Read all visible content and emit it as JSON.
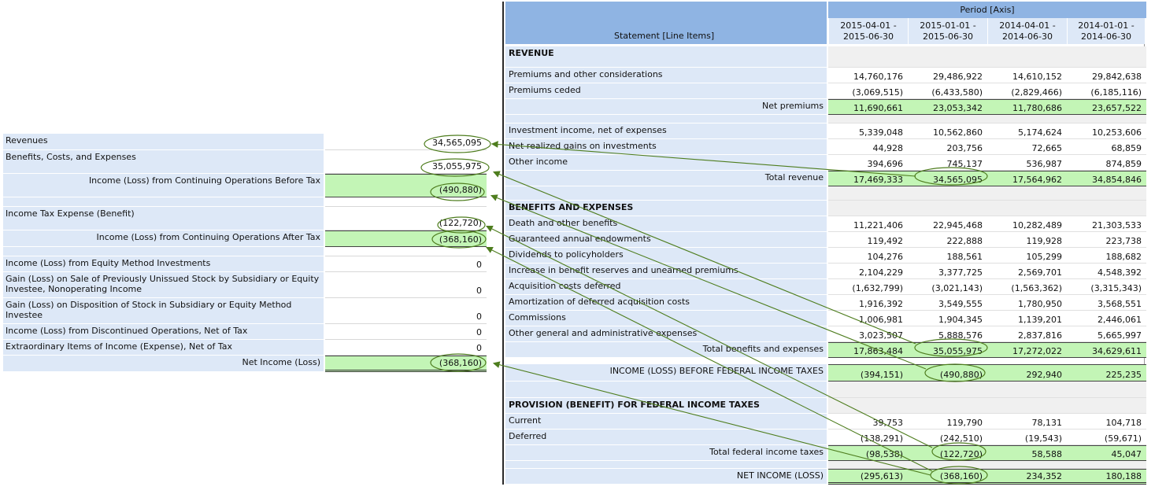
{
  "left_table": {
    "rows": [
      {
        "label": "Revenues",
        "value": "34,565,095"
      },
      {
        "label": "Benefits, Costs, and Expenses",
        "value": "35,055,975"
      },
      {
        "label": "Income (Loss) from Continuing Operations Before Tax",
        "value": "(490,880)"
      },
      {
        "label": "Income Tax Expense (Benefit)",
        "value": "(122,720)"
      },
      {
        "label": "Income (Loss) from Continuing Operations After Tax",
        "value": "(368,160)"
      },
      {
        "label": "Income (Loss) from Equity Method Investments",
        "value": "0"
      },
      {
        "label": "Gain (Loss) on Sale of Previously Unissued Stock by Subsidiary or Equity Investee, Nonoperating Income",
        "value": "0"
      },
      {
        "label": "Gain (Loss) on Disposition of Stock in Subsidiary or Equity Method Investee",
        "value": "0"
      },
      {
        "label": "Income (Loss) from Discontinued Operations, Net of Tax",
        "value": "0"
      },
      {
        "label": "Extraordinary Items of Income (Expense), Net of Tax",
        "value": "0"
      },
      {
        "label": "Net Income (Loss)",
        "value": "(368,160)"
      }
    ]
  },
  "right_table": {
    "header_label": "Statement [Line Items]",
    "period_axis": "Period [Axis]",
    "columns": [
      {
        "line1": "2015-04-01 -",
        "line2": "2015-06-30"
      },
      {
        "line1": "2015-01-01 -",
        "line2": "2015-06-30"
      },
      {
        "line1": "2014-04-01 -",
        "line2": "2014-06-30"
      },
      {
        "line1": "2014-01-01 -",
        "line2": "2014-06-30"
      }
    ],
    "rows": [
      {
        "label": "REVENUE",
        "values": [
          "",
          "",
          "",
          ""
        ]
      },
      {
        "label": "Premiums and other considerations",
        "values": [
          "14,760,176",
          "29,486,922",
          "14,610,152",
          "29,842,638"
        ]
      },
      {
        "label": "Premiums ceded",
        "values": [
          "(3,069,515)",
          "(6,433,580)",
          "(2,829,466)",
          "(6,185,116)"
        ]
      },
      {
        "label": "Net premiums",
        "values": [
          "11,690,661",
          "23,053,342",
          "11,780,686",
          "23,657,522"
        ]
      },
      {
        "label": "",
        "values": [
          "",
          "",
          "",
          ""
        ]
      },
      {
        "label": "Investment income, net of expenses",
        "values": [
          "5,339,048",
          "10,562,860",
          "5,174,624",
          "10,253,606"
        ]
      },
      {
        "label": "Net realized gains on investments",
        "values": [
          "44,928",
          "203,756",
          "72,665",
          "68,859"
        ]
      },
      {
        "label": "Other income",
        "values": [
          "394,696",
          "745,137",
          "536,987",
          "874,859"
        ]
      },
      {
        "label": "Total revenue",
        "values": [
          "17,469,333",
          "34,565,095",
          "17,564,962",
          "34,854,846"
        ]
      },
      {
        "label": "",
        "values": [
          "",
          "",
          "",
          ""
        ]
      },
      {
        "label": "BENEFITS AND EXPENSES",
        "values": [
          "",
          "",
          "",
          ""
        ]
      },
      {
        "label": "Death and other benefits",
        "values": [
          "11,221,406",
          "22,945,468",
          "10,282,489",
          "21,303,533"
        ]
      },
      {
        "label": "Guaranteed annual endowments",
        "values": [
          "119,492",
          "222,888",
          "119,928",
          "223,738"
        ]
      },
      {
        "label": "Dividends to policyholders",
        "values": [
          "104,276",
          "188,561",
          "105,299",
          "188,682"
        ]
      },
      {
        "label": "Increase in benefit reserves and unearned premiums",
        "values": [
          "2,104,229",
          "3,377,725",
          "2,569,701",
          "4,548,392"
        ]
      },
      {
        "label": "Acquisition costs deferred",
        "values": [
          "(1,632,799)",
          "(3,021,143)",
          "(1,563,362)",
          "(3,315,343)"
        ]
      },
      {
        "label": "Amortization of deferred acquisition costs",
        "values": [
          "1,916,392",
          "3,549,555",
          "1,780,950",
          "3,568,551"
        ]
      },
      {
        "label": "Commissions",
        "values": [
          "1,006,981",
          "1,904,345",
          "1,139,201",
          "2,446,061"
        ]
      },
      {
        "label": "Other general and administrative expenses",
        "values": [
          "3,023,507",
          "5,888,576",
          "2,837,816",
          "5,665,997"
        ]
      },
      {
        "label": "Total benefits and expenses",
        "values": [
          "17,863,484",
          "35,055,975",
          "17,272,022",
          "34,629,611"
        ]
      },
      {
        "label": "INCOME (LOSS) BEFORE FEDERAL INCOME TAXES",
        "values": [
          "(394,151)",
          "(490,880)",
          "292,940",
          "225,235"
        ]
      },
      {
        "label": "",
        "values": [
          "",
          "",
          "",
          ""
        ]
      },
      {
        "label": "PROVISION (BENEFIT) FOR FEDERAL INCOME TAXES",
        "values": [
          "",
          "",
          "",
          ""
        ]
      },
      {
        "label": "Current",
        "values": [
          "39,753",
          "119,790",
          "78,131",
          "104,718"
        ]
      },
      {
        "label": "Deferred",
        "values": [
          "(138,291)",
          "(242,510)",
          "(19,543)",
          "(59,671)"
        ]
      },
      {
        "label": "Total federal income taxes",
        "values": [
          "(98,538)",
          "(122,720)",
          "58,588",
          "45,047"
        ]
      },
      {
        "label": "",
        "values": [
          "",
          "",
          "",
          ""
        ]
      },
      {
        "label": "NET INCOME (LOSS)",
        "values": [
          "(295,613)",
          "(368,160)",
          "234,352",
          "180,188"
        ]
      }
    ]
  },
  "colors": {
    "header_blue": "#8fb4e3",
    "label_blue": "#dde8f7",
    "total_green": "#c3f5b6",
    "annotation_green": "#4e7d1e"
  }
}
